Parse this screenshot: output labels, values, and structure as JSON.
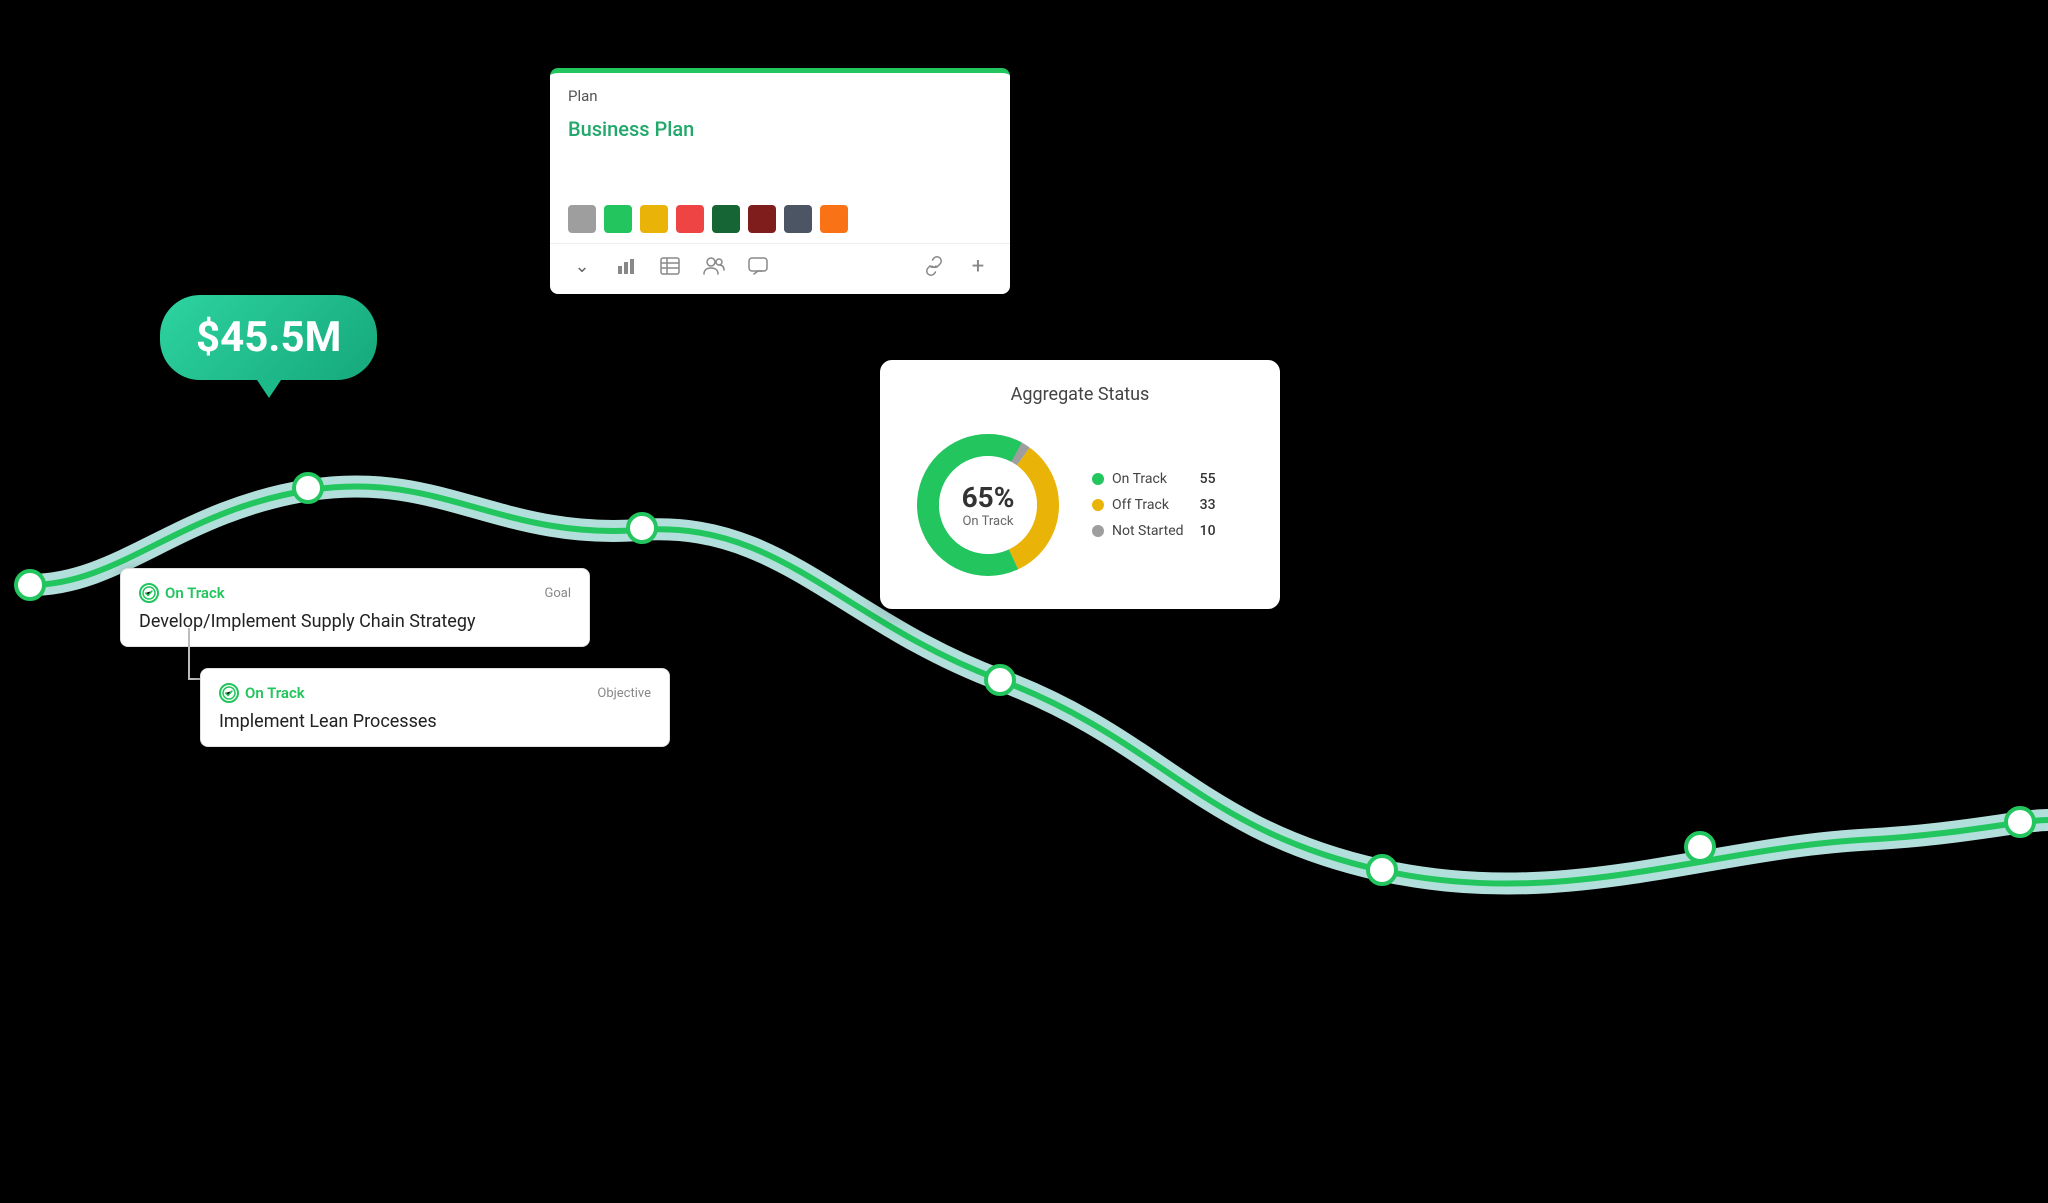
{
  "plan_card": {
    "header": "Plan",
    "title": "Business Plan",
    "colors": [
      {
        "value": "#9e9e9e",
        "name": "gray"
      },
      {
        "value": "#22c55e",
        "name": "green"
      },
      {
        "value": "#eab308",
        "name": "yellow"
      },
      {
        "value": "#ef4444",
        "name": "red"
      },
      {
        "value": "#166534",
        "name": "dark-green"
      },
      {
        "value": "#7f1d1d",
        "name": "dark-red"
      },
      {
        "value": "#4b5563",
        "name": "dark-gray"
      },
      {
        "value": "#f97316",
        "name": "orange"
      }
    ],
    "toolbar_icons": [
      "chevron-down",
      "chart-bar",
      "table",
      "users",
      "chat-bubble",
      "link",
      "plus"
    ]
  },
  "money_bubble": {
    "value": "$45.5M"
  },
  "aggregate_status": {
    "title": "Aggregate Status",
    "percent": "65%",
    "sublabel": "On Track",
    "legend": [
      {
        "label": "On Track",
        "color": "#22c55e",
        "count": 55
      },
      {
        "label": "Off Track",
        "color": "#eab308",
        "count": 33
      },
      {
        "label": "Not Started",
        "color": "#9e9e9e",
        "count": 10
      }
    ]
  },
  "goal_card": {
    "status": "On Track",
    "type": "Goal",
    "text": "Develop/Implement Supply Chain Strategy"
  },
  "objective_card": {
    "status": "On Track",
    "type": "Objective",
    "text": "Implement Lean Processes"
  }
}
